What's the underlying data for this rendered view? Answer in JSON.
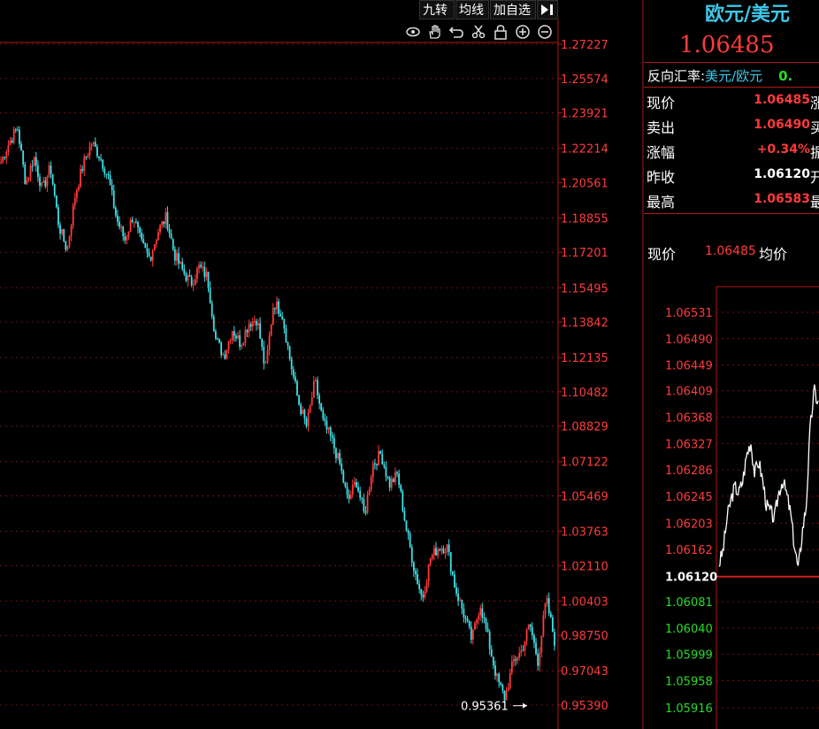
{
  "toolbar": {
    "buttons": [
      "九转",
      "均线",
      "加自选"
    ],
    "exit_icon": "collapse-panel-icon",
    "tools": [
      "eye-icon",
      "hand-icon",
      "undo-icon",
      "cut-icon",
      "lock-icon",
      "zoom-in-icon",
      "zoom-out-icon"
    ]
  },
  "colors": {
    "up": "#ff3b3b",
    "down": "#3fe0e8",
    "grid": "#7a0d0d",
    "axis_text": "#ff3b3b",
    "green": "#2adb2a",
    "title": "#3ec7e8"
  },
  "chart_data": {
    "type": "candlestick",
    "y_ticks": [
      "1.27227",
      "1.25574",
      "1.23921",
      "1.22214",
      "1.20561",
      "1.18855",
      "1.17201",
      "1.15495",
      "1.13842",
      "1.12135",
      "1.10482",
      "1.08829",
      "1.07122",
      "1.05469",
      "1.03763",
      "1.02110",
      "1.00403",
      "0.98750",
      "0.97043",
      "0.95390"
    ],
    "ylim": [
      0.9539,
      1.27227
    ],
    "min_marker": "0.95361",
    "price_path": [
      1.2155,
      1.225,
      1.232,
      1.205,
      1.218,
      1.202,
      1.213,
      1.185,
      1.173,
      1.2,
      1.215,
      1.225,
      1.218,
      1.208,
      1.188,
      1.178,
      1.19,
      1.176,
      1.169,
      1.182,
      1.189,
      1.171,
      1.163,
      1.157,
      1.165,
      1.16,
      1.13,
      1.122,
      1.135,
      1.128,
      1.138,
      1.14,
      1.115,
      1.148,
      1.143,
      1.12,
      1.1,
      1.088,
      1.11,
      1.09,
      1.082,
      1.07,
      1.052,
      1.062,
      1.045,
      1.07,
      1.075,
      1.06,
      1.065,
      1.04,
      1.02,
      1.005,
      1.025,
      1.03,
      1.03,
      1.01,
      0.998,
      0.985,
      1.003,
      0.985,
      0.967,
      0.957,
      0.975,
      0.98,
      0.993,
      0.975,
      1.005,
      0.985
    ]
  },
  "quote": {
    "title": "欧元/美元 ",
    "price": "1.06485",
    "reverse_label": "反向汇率:",
    "reverse_pair": "美元/欧元",
    "reverse_value": "0.",
    "rows": [
      {
        "label": "现价",
        "value": "1.06485",
        "tail": "涨"
      },
      {
        "label": "卖出",
        "value": "1.06490",
        "tail": "买"
      },
      {
        "label": "涨幅",
        "value": "+0.34%",
        "tail": "振"
      },
      {
        "label": "昨收",
        "value": "1.06120",
        "tail": "开"
      },
      {
        "label": "最高",
        "value": "1.06583",
        "tail": "最"
      }
    ]
  },
  "intraday": {
    "now_label": "现价",
    "now_value": "1.06485",
    "avg_label": "均价",
    "y_ticks": [
      "1.06531",
      "1.06490",
      "1.06449",
      "1.06409",
      "1.06368",
      "1.06327",
      "1.06286",
      "1.06245",
      "1.06203",
      "1.06162",
      "1.06120",
      "1.06081",
      "1.06040",
      "1.05999",
      "1.05958",
      "1.05916"
    ],
    "prev_close": "1.06120",
    "path": [
      1.0614,
      1.0616,
      1.0621,
      1.0624,
      1.0626,
      1.0625,
      1.0627,
      1.0631,
      1.0633,
      1.0628,
      1.063,
      1.0627,
      1.0623,
      1.0622,
      1.0621,
      1.0625,
      1.0627,
      1.0625,
      1.0622,
      1.0617,
      1.0613,
      1.0619,
      1.0623,
      1.0635,
      1.0641,
      1.0639
    ]
  }
}
